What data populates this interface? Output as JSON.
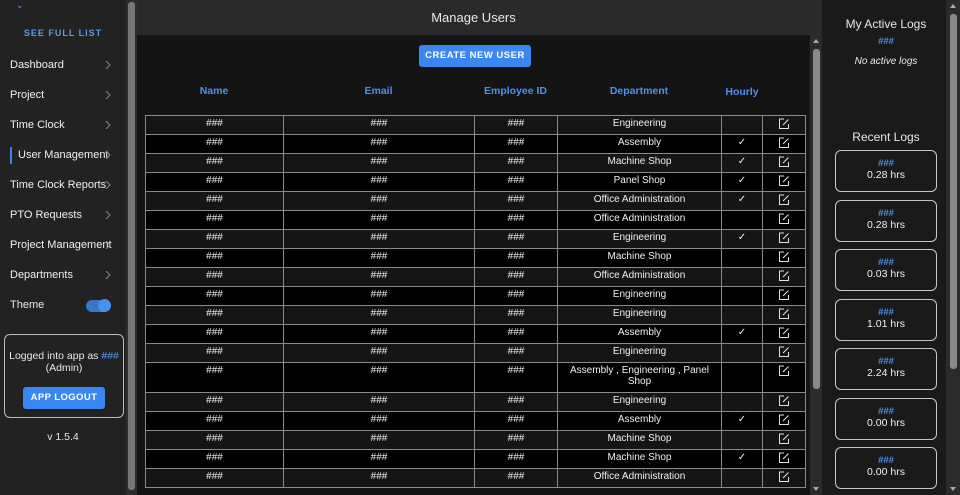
{
  "sidebar": {
    "see_full_list": "SEE FULL LIST",
    "items": [
      {
        "label": "Dashboard"
      },
      {
        "label": "Project"
      },
      {
        "label": "Time Clock"
      },
      {
        "label": "User Management"
      },
      {
        "label": "Time Clock Reports"
      },
      {
        "label": "PTO Requests"
      },
      {
        "label": "Project Management"
      },
      {
        "label": "Departments"
      }
    ],
    "theme_label": "Theme",
    "logged_in_prefix": "Logged into app as",
    "logged_in_user": "###",
    "logged_in_role": "(Admin)",
    "logout_label": "APP LOGOUT",
    "version": "v 1.5.4"
  },
  "main": {
    "title": "Manage Users",
    "create_label": "CREATE NEW USER",
    "headers": {
      "name": "Name",
      "email": "Email",
      "employee_id": "Employee ID",
      "department": "Department",
      "hourly": "Hourly"
    },
    "rows": [
      {
        "name": "###",
        "email": "###",
        "id": "###",
        "dept": "Engineering",
        "hourly": ""
      },
      {
        "name": "###",
        "email": "###",
        "id": "###",
        "dept": "Assembly",
        "hourly": "✓"
      },
      {
        "name": "###",
        "email": "###",
        "id": "###",
        "dept": "Machine Shop",
        "hourly": "✓"
      },
      {
        "name": "###",
        "email": "###",
        "id": "###",
        "dept": "Panel Shop",
        "hourly": "✓"
      },
      {
        "name": "###",
        "email": "###",
        "id": "###",
        "dept": "Office Administration",
        "hourly": "✓"
      },
      {
        "name": "###",
        "email": "###",
        "id": "###",
        "dept": "Office Administration",
        "hourly": ""
      },
      {
        "name": "###",
        "email": "###",
        "id": "###",
        "dept": "Engineering",
        "hourly": "✓"
      },
      {
        "name": "###",
        "email": "###",
        "id": "###",
        "dept": "Machine Shop",
        "hourly": ""
      },
      {
        "name": "###",
        "email": "###",
        "id": "###",
        "dept": "Office Administration",
        "hourly": ""
      },
      {
        "name": "###",
        "email": "###",
        "id": "###",
        "dept": "Engineering",
        "hourly": ""
      },
      {
        "name": "###",
        "email": "###",
        "id": "###",
        "dept": "Engineering",
        "hourly": ""
      },
      {
        "name": "###",
        "email": "###",
        "id": "###",
        "dept": "Assembly",
        "hourly": "✓"
      },
      {
        "name": "###",
        "email": "###",
        "id": "###",
        "dept": "Engineering",
        "hourly": ""
      },
      {
        "name": "###",
        "email": "###",
        "id": "###",
        "dept": "Assembly , Engineering , Panel Shop",
        "hourly": ""
      },
      {
        "name": "###",
        "email": "###",
        "id": "###",
        "dept": "Engineering",
        "hourly": ""
      },
      {
        "name": "###",
        "email": "###",
        "id": "###",
        "dept": "Assembly",
        "hourly": "✓"
      },
      {
        "name": "###",
        "email": "###",
        "id": "###",
        "dept": "Machine Shop",
        "hourly": ""
      },
      {
        "name": "###",
        "email": "###",
        "id": "###",
        "dept": "Machine Shop",
        "hourly": "✓"
      },
      {
        "name": "###",
        "email": "###",
        "id": "###",
        "dept": "Office Administration",
        "hourly": ""
      }
    ]
  },
  "right": {
    "active_title": "My Active Logs",
    "active_user": "###",
    "active_empty": "No active logs",
    "recent_title": "Recent Logs",
    "recent": [
      {
        "user": "###",
        "hours": "0.28 hrs"
      },
      {
        "user": "###",
        "hours": "0.28 hrs"
      },
      {
        "user": "###",
        "hours": "0.03 hrs"
      },
      {
        "user": "###",
        "hours": "1.01 hrs"
      },
      {
        "user": "###",
        "hours": "2.24 hrs"
      },
      {
        "user": "###",
        "hours": "0.00 hrs"
      },
      {
        "user": "###",
        "hours": "0.00 hrs"
      }
    ]
  },
  "colors": {
    "accent": "#3b87f2",
    "header_text": "#4d90ee"
  }
}
